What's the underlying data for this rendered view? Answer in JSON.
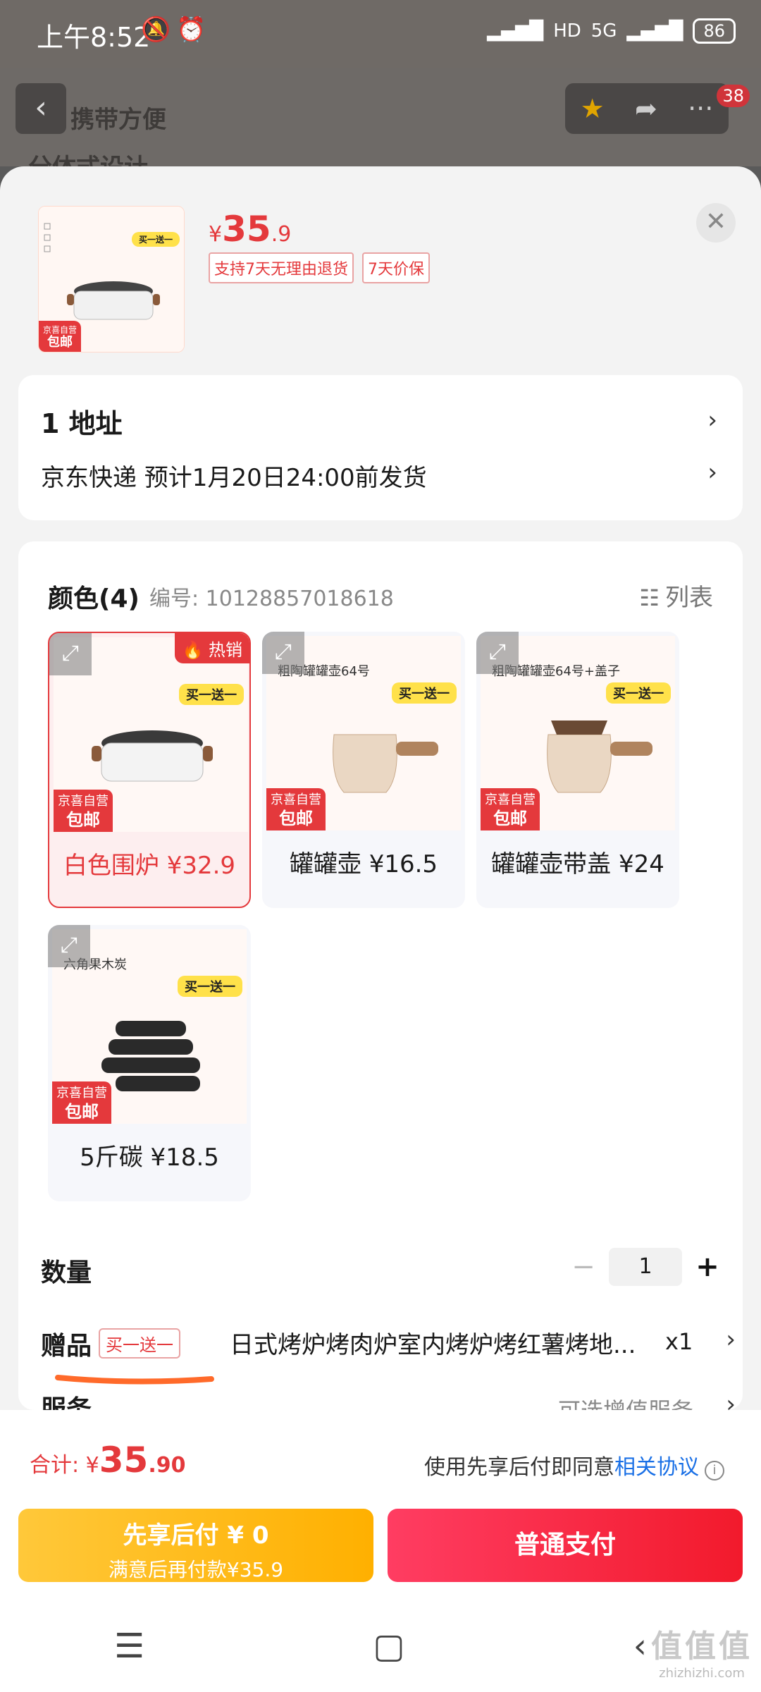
{
  "status_bar": {
    "time": "上午8:52",
    "network": "5G",
    "hd": "HD",
    "battery": "86"
  },
  "background_page": {
    "ghost_line1": "携带方便",
    "ghost_line2": "分体式设计",
    "cart_count": "38"
  },
  "header": {
    "price_symbol": "¥",
    "price_int": "35",
    "price_dec": ".9",
    "tags": [
      "支持7天无理由退货",
      "7天价保"
    ],
    "badge_top": "京喜自营",
    "badge_bottom": "包邮",
    "promo": "买一送一"
  },
  "address": {
    "title": "1  地址",
    "delivery": "京东快递 预计1月20日24:00前发货"
  },
  "color_section": {
    "title": "颜色(4)",
    "sku_no": "编号: 10128857018618",
    "list_label": "列表",
    "hot_label": "热销",
    "options": [
      {
        "label": "白色围炉 ¥32.9",
        "caption": "",
        "selected": true
      },
      {
        "label": "罐罐壶 ¥16.5",
        "caption": "粗陶罐罐壶64号",
        "selected": false
      },
      {
        "label": "罐罐壶带盖 ¥24",
        "caption": "粗陶罐罐壶64号+盖子",
        "selected": false
      },
      {
        "label": "5斤碳 ¥18.5",
        "caption": "六角果木炭",
        "selected": false
      }
    ]
  },
  "quantity": {
    "label": "数量",
    "minus": "−",
    "value": "1",
    "plus": "+"
  },
  "gift": {
    "label": "赠品",
    "tag": "买一送一",
    "text": "日式烤炉烤肉炉室内烤炉烤红薯烤地...",
    "qty": "x1"
  },
  "service": {
    "label": "服务",
    "option": "可选增值服务"
  },
  "total": {
    "label": "合计: ",
    "symbol": "¥",
    "int": "35",
    "dec": ".90"
  },
  "agreement": {
    "text": "使用先享后付即同意",
    "link": "相关协议"
  },
  "buttons": {
    "pay_later_line1": "先享后付 ¥ 0",
    "pay_later_line2": "满意后再付款¥35.9",
    "pay": "普通支付"
  },
  "watermark": {
    "big": "值值值",
    "small": "zhizhizhi.com"
  }
}
